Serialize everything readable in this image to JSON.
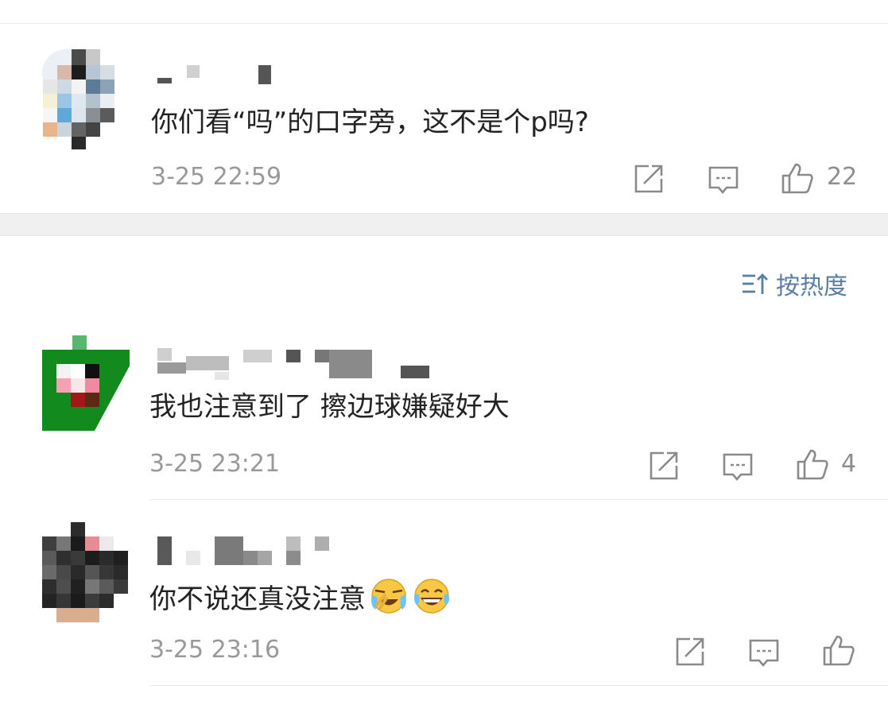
{
  "sort": {
    "label": "按热度"
  },
  "comments": [
    {
      "text": "你们看“吗”的口字旁，这不是个p吗?",
      "time": "3-25 22:59",
      "likes": "22"
    },
    {
      "text": "我也注意到了 擦边球嫌疑好大",
      "time": "3-25 23:21",
      "likes": "4"
    },
    {
      "text": "你不说还真没注意",
      "time": "3-25 23:16",
      "likes": ""
    }
  ],
  "colors": {
    "accent": "#5a7ea4",
    "meta": "#999999",
    "icon": "#8a8a8a"
  }
}
